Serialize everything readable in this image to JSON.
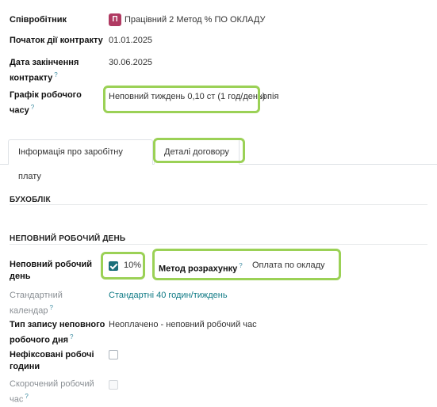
{
  "employee": {
    "label": "Співробітник",
    "avatar_letter": "П",
    "avatar_color": "#b03a62",
    "value": "Працівний 2 Метод % ПО ОКЛАДУ"
  },
  "contract_start": {
    "label": "Початок дії контракту",
    "value": "01.01.2025"
  },
  "contract_end": {
    "label_line1": "Дата закінчення",
    "label_line2": "контракту",
    "help": "?",
    "value": "30.06.2025"
  },
  "work_schedule": {
    "label_line1": "Графік робочого",
    "label_line2": "часу",
    "help": "?",
    "value": "Неповний тиждень 0,10 ст (1 год/день)",
    "suffix": "копія"
  },
  "tabs": [
    {
      "label": "Інформація про заробітну плату",
      "active": false
    },
    {
      "label": "Деталі договору",
      "active": true
    }
  ],
  "sections": {
    "accounting": "БУХОБЛІК",
    "part_time": "НЕПОВНИЙ РОБОЧИЙ ДЕНЬ"
  },
  "part_time_day": {
    "label_line1": "Неповний робочий",
    "label_line2": "день",
    "checked": true,
    "percent": "10%"
  },
  "calc_method": {
    "label": "Метод розрахунку",
    "help": "?",
    "value": "Оплата по окладу"
  },
  "standard_calendar": {
    "label_line1": "Стандартний",
    "label_line2": "календар",
    "help": "?",
    "value": "Стандартні 40 годин/тиждень"
  },
  "entry_type": {
    "label_line1": "Тип запису неповного",
    "label_line2": "робочого дня",
    "help": "?",
    "value": "Неоплачено - неповний робочий час"
  },
  "unfixed_hours": {
    "label_line1": "Нефіксовані робочі",
    "label_line2": "години",
    "checked": false
  },
  "reduced_time": {
    "label_line1": "Скорочений робочий",
    "label_line2": "час",
    "help": "?",
    "checked": false
  },
  "colors": {
    "highlight": "#9bd156",
    "accent": "#0f7a85",
    "checkbox": "#1b6f7a"
  }
}
